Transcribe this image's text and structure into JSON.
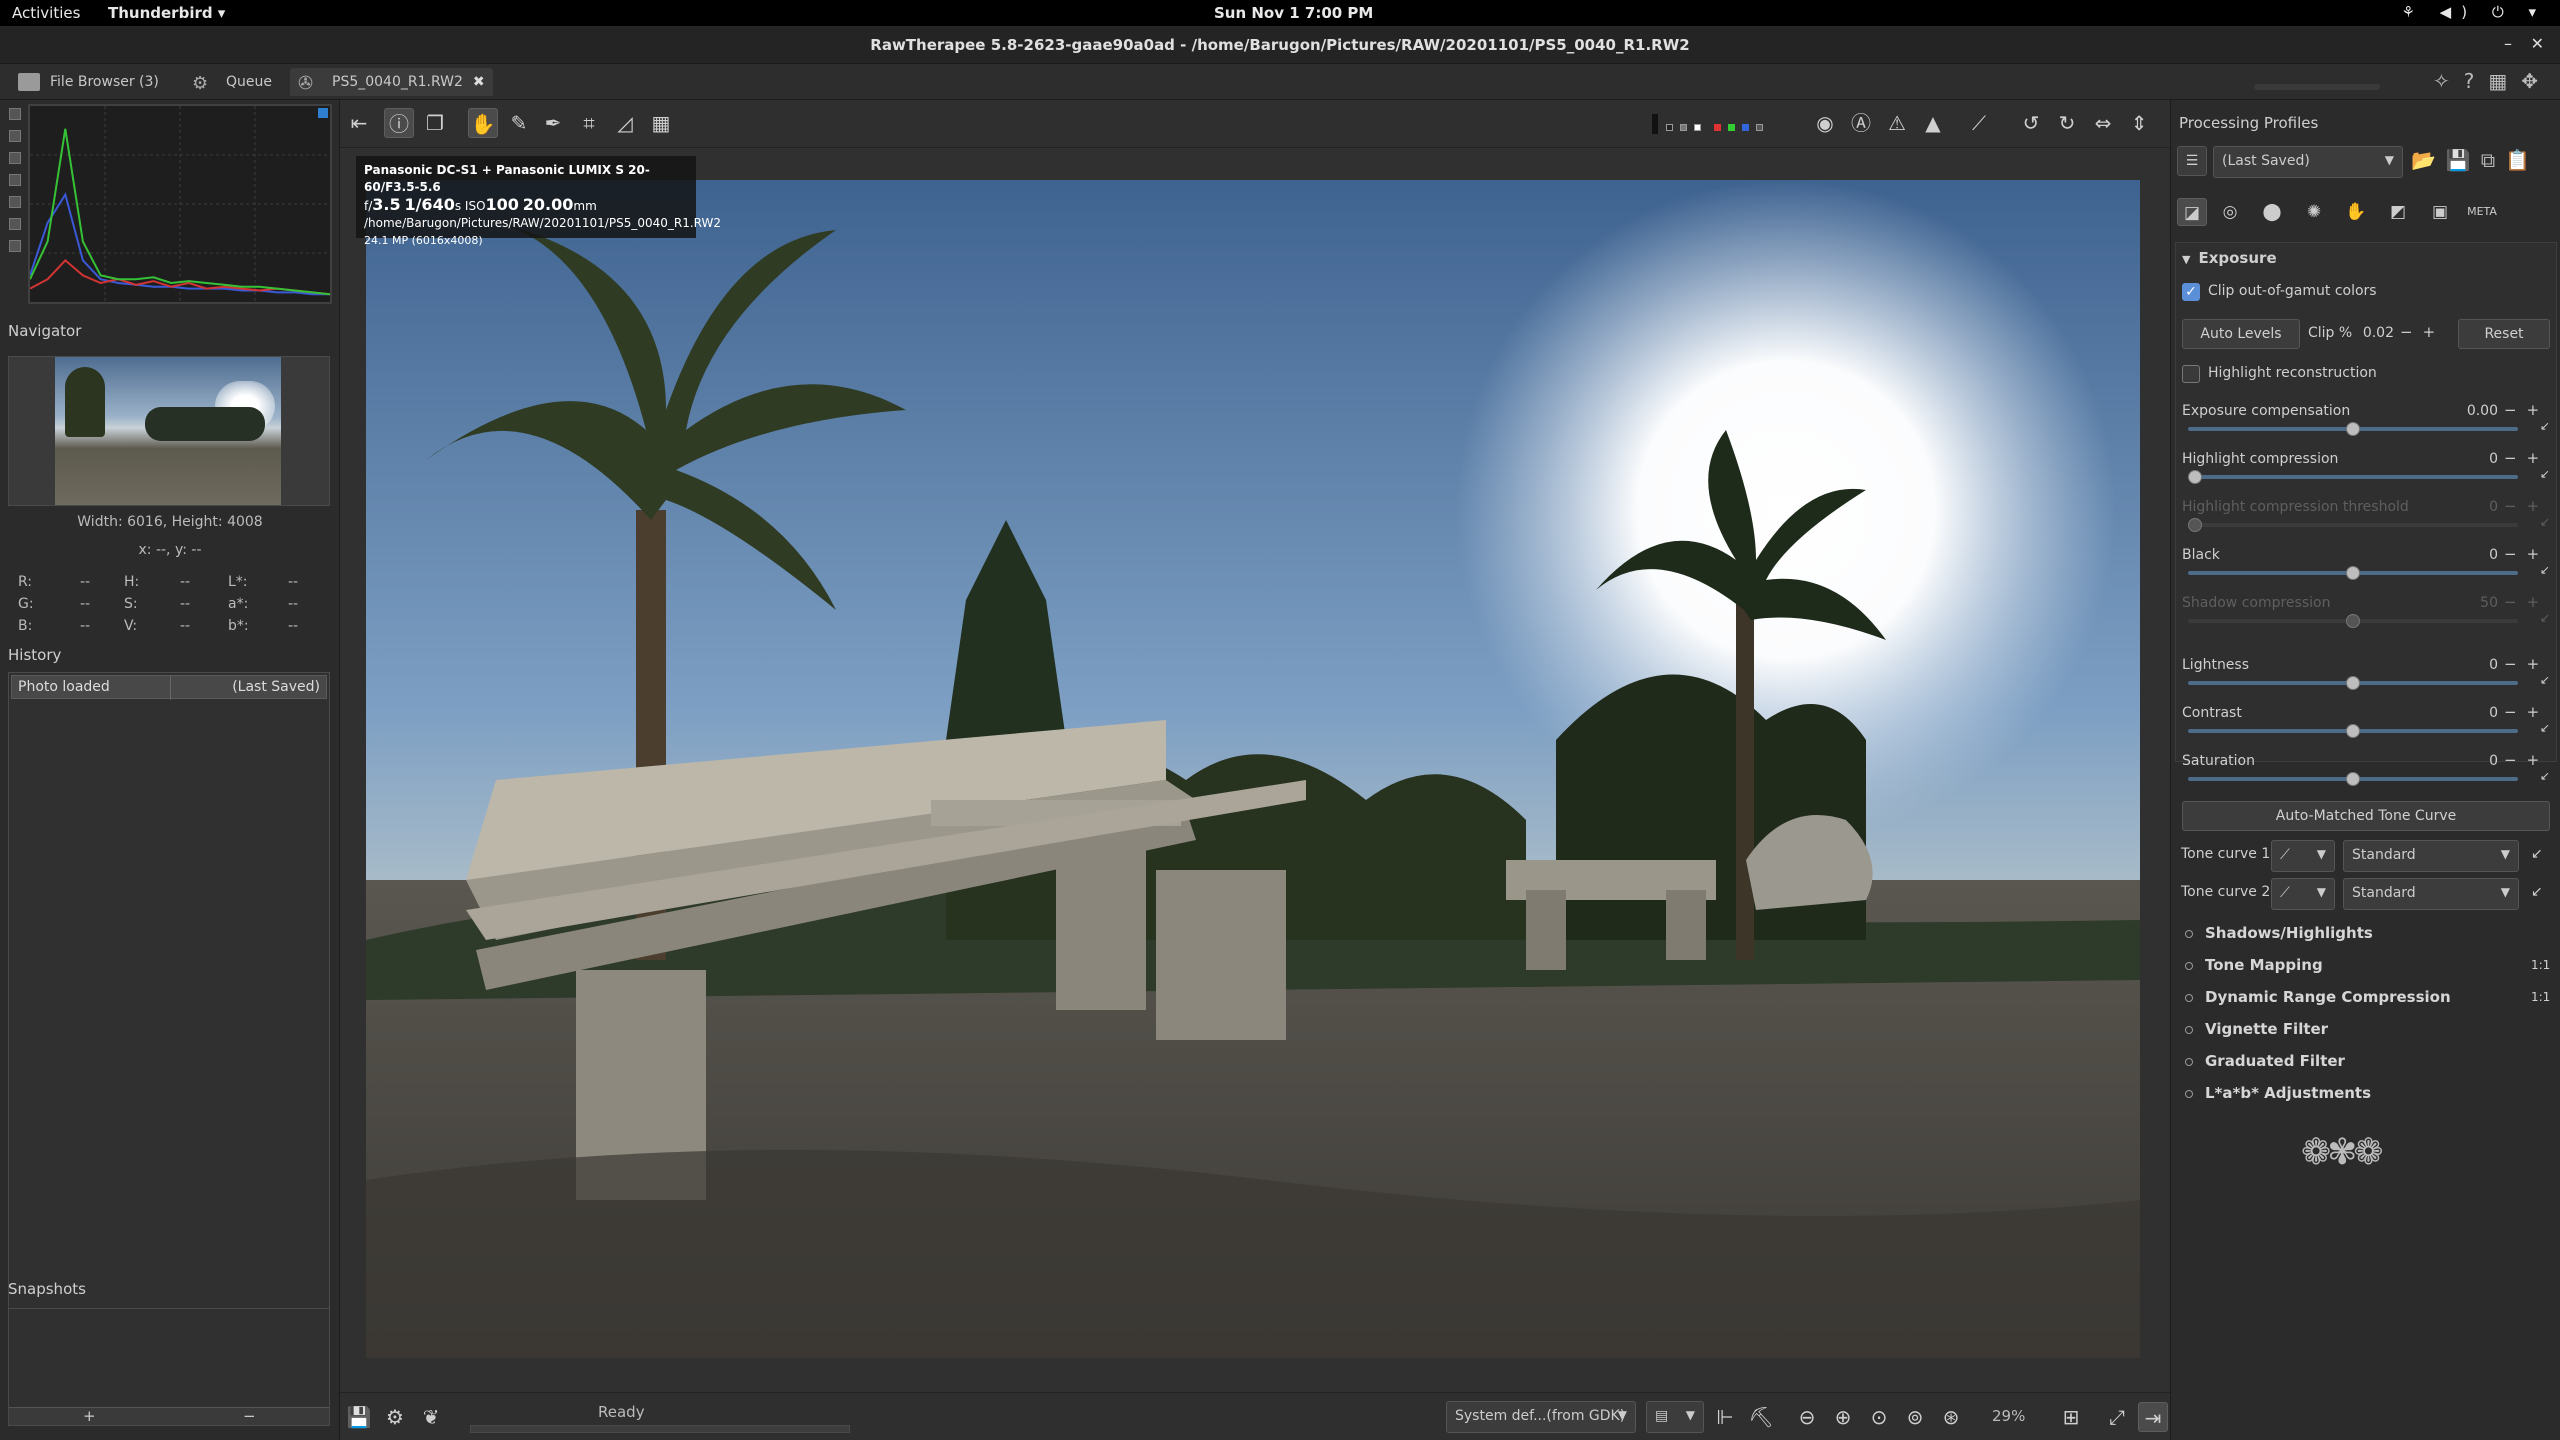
{
  "gnome": {
    "activities": "Activities",
    "app": "Thunderbird ▾",
    "clock": "Sun Nov 1   7:00 PM",
    "tray": "⚘ ◀) ⏻ ▾"
  },
  "window": {
    "title": "RawTherapee 5.8-2623-gaae90a0ad - /home/Barugon/Pictures/RAW/20201101/PS5_0040_R1.RW2"
  },
  "tabs": [
    {
      "label": "File Browser (3)"
    },
    {
      "label": "Queue"
    },
    {
      "label": "PS5_0040_R1.RW2"
    }
  ],
  "navigator": {
    "title": "Navigator",
    "dims": "Width: 6016, Height: 4008",
    "xy": "x: --, y: --"
  },
  "readouts": [
    [
      "R:",
      "--",
      "H:",
      "--",
      "L*:",
      "--"
    ],
    [
      "G:",
      "--",
      "S:",
      "--",
      "a*:",
      "--"
    ],
    [
      "B:",
      "--",
      "V:",
      "--",
      "b*:",
      "--"
    ]
  ],
  "history": {
    "title": "History",
    "entry": "Photo loaded",
    "profile": "(Last Saved)"
  },
  "snapshots": {
    "title": "Snapshots",
    "add": "+",
    "remove": "−"
  },
  "exif": {
    "camera": "Panasonic DC-S1 + Panasonic LUMIX S 20-60/F3.5-5.6",
    "shot_f": "f/",
    "shot_fval": "3.5",
    "shot_exp": "1/640",
    "shot_s": "s",
    "shot_iso": "ISO",
    "shot_isoval": "100",
    "shot_focal": "20.00",
    "shot_mm": "mm",
    "path": "/home/Barugon/Pictures/RAW/20201101/PS5_0040_R1.RW2",
    "mp": "24.1 MP (6016x4008)"
  },
  "status": {
    "ready": "Ready",
    "monitor_profile": "System def...(from GDK)",
    "zoom": "29%"
  },
  "profiles": {
    "title": "Processing Profiles",
    "selected": "(Last Saved)"
  },
  "exposure": {
    "title": "Exposure",
    "clip_gamut": "Clip out-of-gamut colors",
    "auto_levels": "Auto Levels",
    "clip_label": "Clip %",
    "clip_value": "0.02",
    "reset": "Reset",
    "highlight_recon": "Highlight reconstruction",
    "sliders": [
      {
        "label": "Exposure compensation",
        "value": "0.00",
        "dim": false
      },
      {
        "label": "Highlight compression",
        "value": "0",
        "dim": false
      },
      {
        "label": "Highlight compression threshold",
        "value": "0",
        "dim": true
      },
      {
        "label": "Black",
        "value": "0",
        "dim": false
      },
      {
        "label": "Shadow compression",
        "value": "50",
        "dim": true
      },
      {
        "label": "Lightness",
        "value": "0",
        "dim": false
      },
      {
        "label": "Contrast",
        "value": "0",
        "dim": false
      },
      {
        "label": "Saturation",
        "value": "0",
        "dim": false
      }
    ],
    "auto_tone": "Auto-Matched Tone Curve",
    "tone1": "Tone curve 1:",
    "tone2": "Tone curve 2:",
    "standard": "Standard"
  },
  "tools": [
    {
      "label": "Shadows/Highlights",
      "badge": ""
    },
    {
      "label": "Tone Mapping",
      "badge": "1:1"
    },
    {
      "label": "Dynamic Range Compression",
      "badge": "1:1"
    },
    {
      "label": "Vignette Filter",
      "badge": ""
    },
    {
      "label": "Graduated Filter",
      "badge": ""
    },
    {
      "label": "L*a*b* Adjustments",
      "badge": ""
    }
  ],
  "histogram": {
    "red": [
      0.05,
      0.1,
      0.2,
      0.12,
      0.08,
      0.1,
      0.07,
      0.09,
      0.06,
      0.08,
      0.05,
      0.06,
      0.05,
      0.04,
      0.05,
      0.04,
      0.03,
      0.02
    ],
    "green": [
      0.1,
      0.3,
      0.9,
      0.3,
      0.12,
      0.1,
      0.1,
      0.11,
      0.08,
      0.09,
      0.08,
      0.07,
      0.06,
      0.06,
      0.05,
      0.04,
      0.03,
      0.02
    ],
    "blue": [
      0.12,
      0.4,
      0.55,
      0.2,
      0.1,
      0.08,
      0.07,
      0.06,
      0.06,
      0.05,
      0.05,
      0.05,
      0.04,
      0.04,
      0.03,
      0.03,
      0.02,
      0.02
    ]
  }
}
